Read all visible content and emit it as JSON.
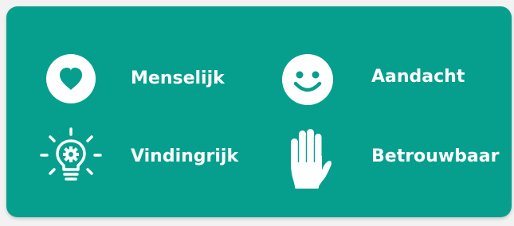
{
  "values": {
    "items": [
      {
        "label": "Menselijk",
        "icon": "heart-icon"
      },
      {
        "label": "Aandacht",
        "icon": "smiley-icon"
      },
      {
        "label": "Vindingrijk",
        "icon": "lightbulb-gear-icon"
      },
      {
        "label": "Betrouwbaar",
        "icon": "hand-icon"
      }
    ]
  },
  "colors": {
    "background": "#069f8e",
    "foreground": "#ffffff"
  }
}
